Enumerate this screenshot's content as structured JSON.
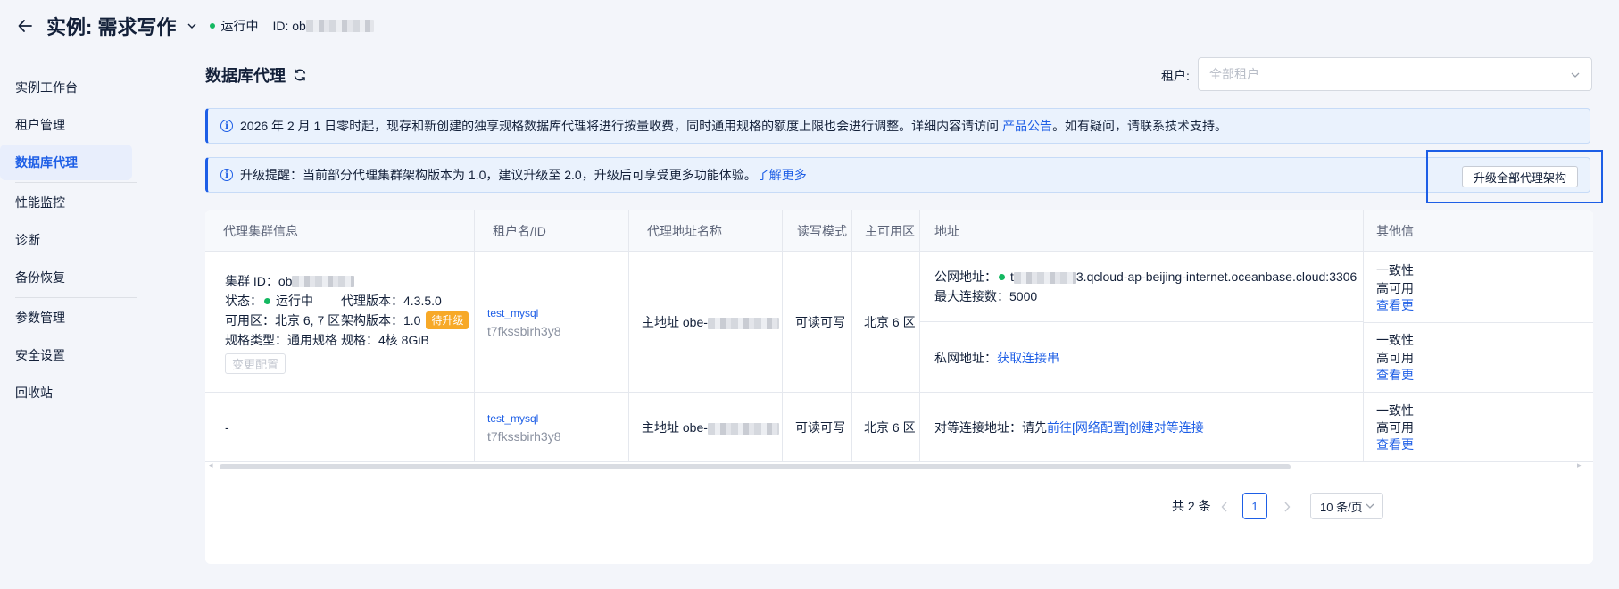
{
  "header": {
    "title": "实例: 需求写作",
    "status": "运行中",
    "id_label": "ID: ob"
  },
  "sidebar": {
    "items": [
      {
        "label": "实例工作台"
      },
      {
        "label": "租户管理"
      },
      {
        "label": "数据库代理",
        "active": true
      },
      {
        "label": "性能监控"
      },
      {
        "label": "诊断"
      },
      {
        "label": "备份恢复"
      },
      {
        "label": "参数管理"
      },
      {
        "label": "安全设置"
      },
      {
        "label": "回收站"
      }
    ]
  },
  "main": {
    "page_title": "数据库代理",
    "tenant_label": "租户:",
    "tenant_placeholder": "全部租户",
    "notice": {
      "text": "2026 年 2 月 1 日零时起，现存和新创建的独享规格数据库代理将进行按量收费，同时通用规格的额度上限也会进行调整。详细内容请访问",
      "link": "产品公告",
      "suffix": "。如有疑问，请联系技术支持。"
    },
    "upgrade_alert": {
      "text": "升级提醒：当前部分代理集群架构版本为 1.0，建议升级至 2.0，升级后可享受更多功能体验。",
      "link": "了解更多",
      "button": "升级全部代理架构"
    }
  },
  "table": {
    "columns": [
      "代理集群信息",
      "租户名/ID",
      "代理地址名称",
      "读写模式",
      "主可用区",
      "地址",
      "其他信"
    ],
    "rows": [
      {
        "cluster_id_label": "集群 ID：",
        "cluster_id": "ob",
        "status_label": "状态：",
        "status": "运行中",
        "proxy_version_label": "代理版本：",
        "proxy_version": "4.3.5.0",
        "zone_label": "可用区：",
        "zone": "北京 6, 7 区",
        "arch_version_label": "架构版本：",
        "arch_version": "1.0",
        "arch_badge": "待升级",
        "spec_type_label": "规格类型：",
        "spec_type": "通用规格",
        "spec_label": "规格：",
        "spec": "4核 8GiB",
        "change_btn": "变更配置",
        "tenant_name": "test_mysql",
        "tenant_id": "t7fkssbirh3y8",
        "addr_name": "主地址 obe-",
        "rw_mode": "可读可写",
        "primary_zone": "北京 6 区",
        "public_label": "公网地址：",
        "public_prefix": "t",
        "public_addr": "3.qcloud-ap-beijing-internet.oceanbase.cloud:3306",
        "max_conn_label": "最大连接数：",
        "max_conn": "5000",
        "private_label": "私网地址：",
        "private_link": "获取连接串",
        "other_1": "一致性",
        "other_2": "高可用",
        "other_3": "查看更",
        "other_4": "一致性",
        "other_5": "高可用",
        "other_6": "查看更"
      },
      {
        "cluster_info": "-",
        "tenant_name": "test_mysql",
        "tenant_id": "t7fkssbirh3y8",
        "addr_name": "主地址 obe-",
        "rw_mode": "可读可写",
        "primary_zone": "北京 6 区",
        "peer_label": "对等连接地址：请先",
        "peer_link": "前往[网络配置]创建对等连接",
        "other_1": "一致性",
        "other_2": "高可用",
        "other_3": "查看更"
      }
    ]
  },
  "pagination": {
    "total": "共 2 条",
    "current_page": "1",
    "page_size": "10 条/页"
  },
  "colors": {
    "accent": "#1d5ee6",
    "success": "#14b861",
    "warning": "#f7a928"
  }
}
